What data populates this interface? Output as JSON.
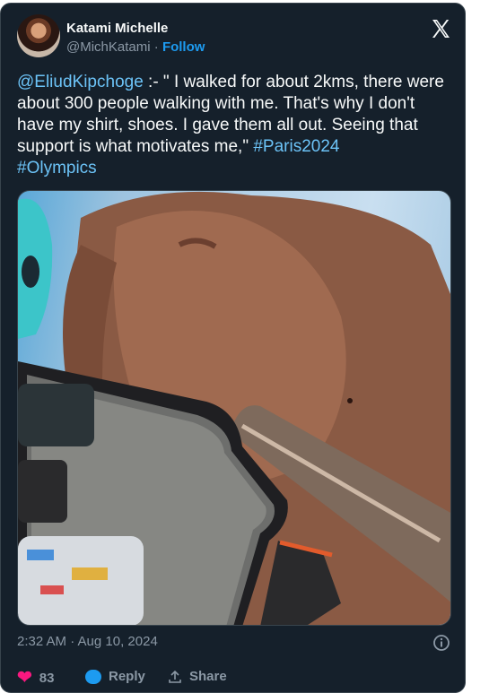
{
  "author": {
    "name": "Katami Michelle",
    "handle": "@MichKatami",
    "separator": "·",
    "follow_label": "Follow"
  },
  "tweet": {
    "mention": "@EliudKipchoge",
    "body": " :- \" I walked for about 2kms, there were about 300 people walking with me. That's why I don't have my shirt, shoes. I gave them all out. Seeing that support is what motivates me,\"  ",
    "hashtags": [
      "#Paris2024",
      "#Olympics"
    ]
  },
  "meta": {
    "timestamp": "2:32 AM · Aug 10, 2024"
  },
  "actions": {
    "like_count": "83",
    "reply_label": "Reply",
    "share_label": "Share"
  },
  "colors": {
    "background": "#15202b",
    "link": "#6cc3f7",
    "heart": "#f91880",
    "muted": "#8b98a5"
  },
  "icons": [
    "x-logo-icon",
    "info-icon",
    "heart-icon",
    "reply-icon",
    "share-icon"
  ]
}
